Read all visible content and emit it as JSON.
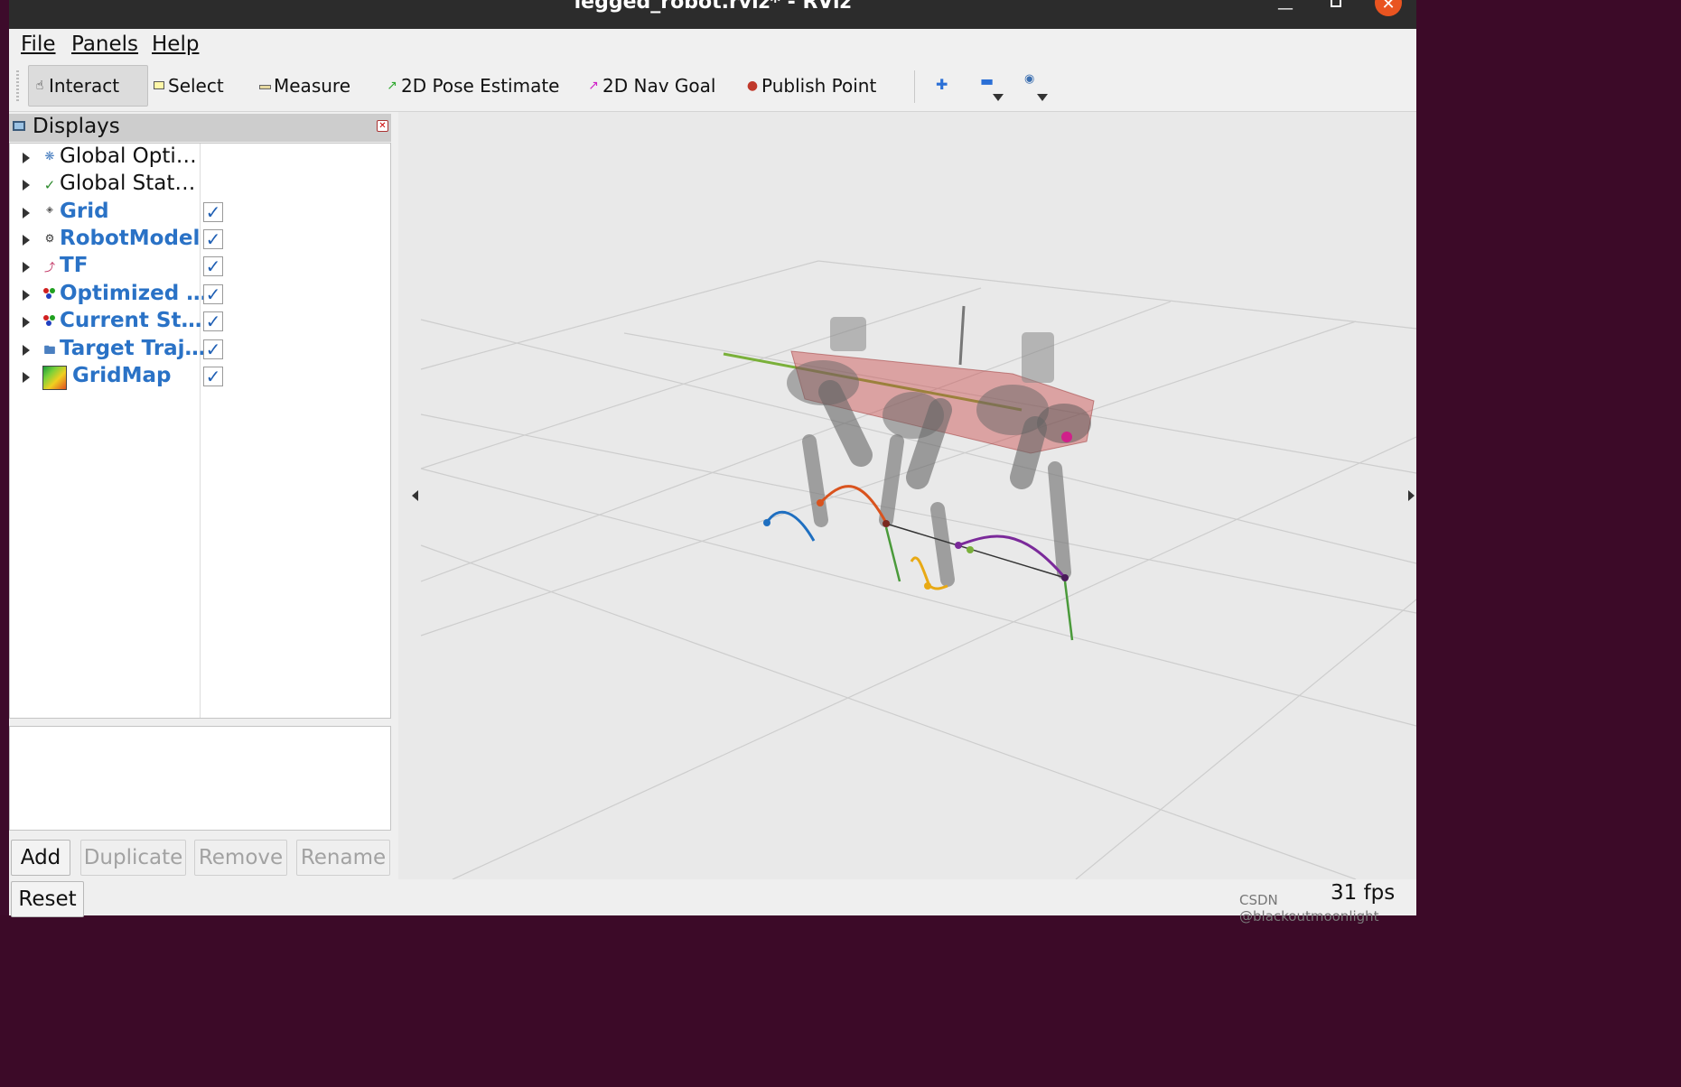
{
  "window": {
    "title": "legged_robot.rviz* - RViz"
  },
  "menubar": {
    "file": "File",
    "panels": "Panels",
    "help": "Help"
  },
  "toolbar": {
    "tools": [
      "Interact",
      "Select",
      "Measure",
      "2D Pose Estimate",
      "2D Nav Goal",
      "Publish Point"
    ],
    "active_tool": "Interact",
    "tool_icons": [
      "hand-cursor-icon",
      "select-box-icon",
      "ruler-icon",
      "pose-arrow-icon",
      "nav-goal-arrow-icon",
      "pin-icon"
    ]
  },
  "displays_panel": {
    "title": "Displays",
    "items": [
      {
        "label": "Global Opti…",
        "checked": null,
        "icon": "gear-icon",
        "bold": false
      },
      {
        "label": "Global Stat…",
        "checked": null,
        "icon": "checkmark-icon",
        "bold": false
      },
      {
        "label": "Grid",
        "checked": true,
        "icon": "grid-icon",
        "bold": true
      },
      {
        "label": "RobotModel",
        "checked": true,
        "icon": "robot-icon",
        "bold": true
      },
      {
        "label": "TF",
        "checked": true,
        "icon": "axes-icon",
        "bold": true
      },
      {
        "label": "Optimized …",
        "checked": true,
        "icon": "marker-array-icon",
        "bold": true
      },
      {
        "label": "Current St…",
        "checked": true,
        "icon": "marker-array-icon",
        "bold": true
      },
      {
        "label": "Target Traj…",
        "checked": true,
        "icon": "folder-icon",
        "bold": true
      },
      {
        "label": "GridMap",
        "checked": true,
        "icon": "gridmap-icon",
        "bold": true
      }
    ],
    "buttons": {
      "add": "Add",
      "duplicate": "Duplicate",
      "remove": "Remove",
      "rename": "Rename",
      "reset": "Reset"
    }
  },
  "status": {
    "fps": "31 fps"
  },
  "watermark": "CSDN @blackoutmoonlight",
  "colors": {
    "accent": "#2a72c6",
    "titlebar": "#2c2c2c",
    "close": "#e95420"
  }
}
